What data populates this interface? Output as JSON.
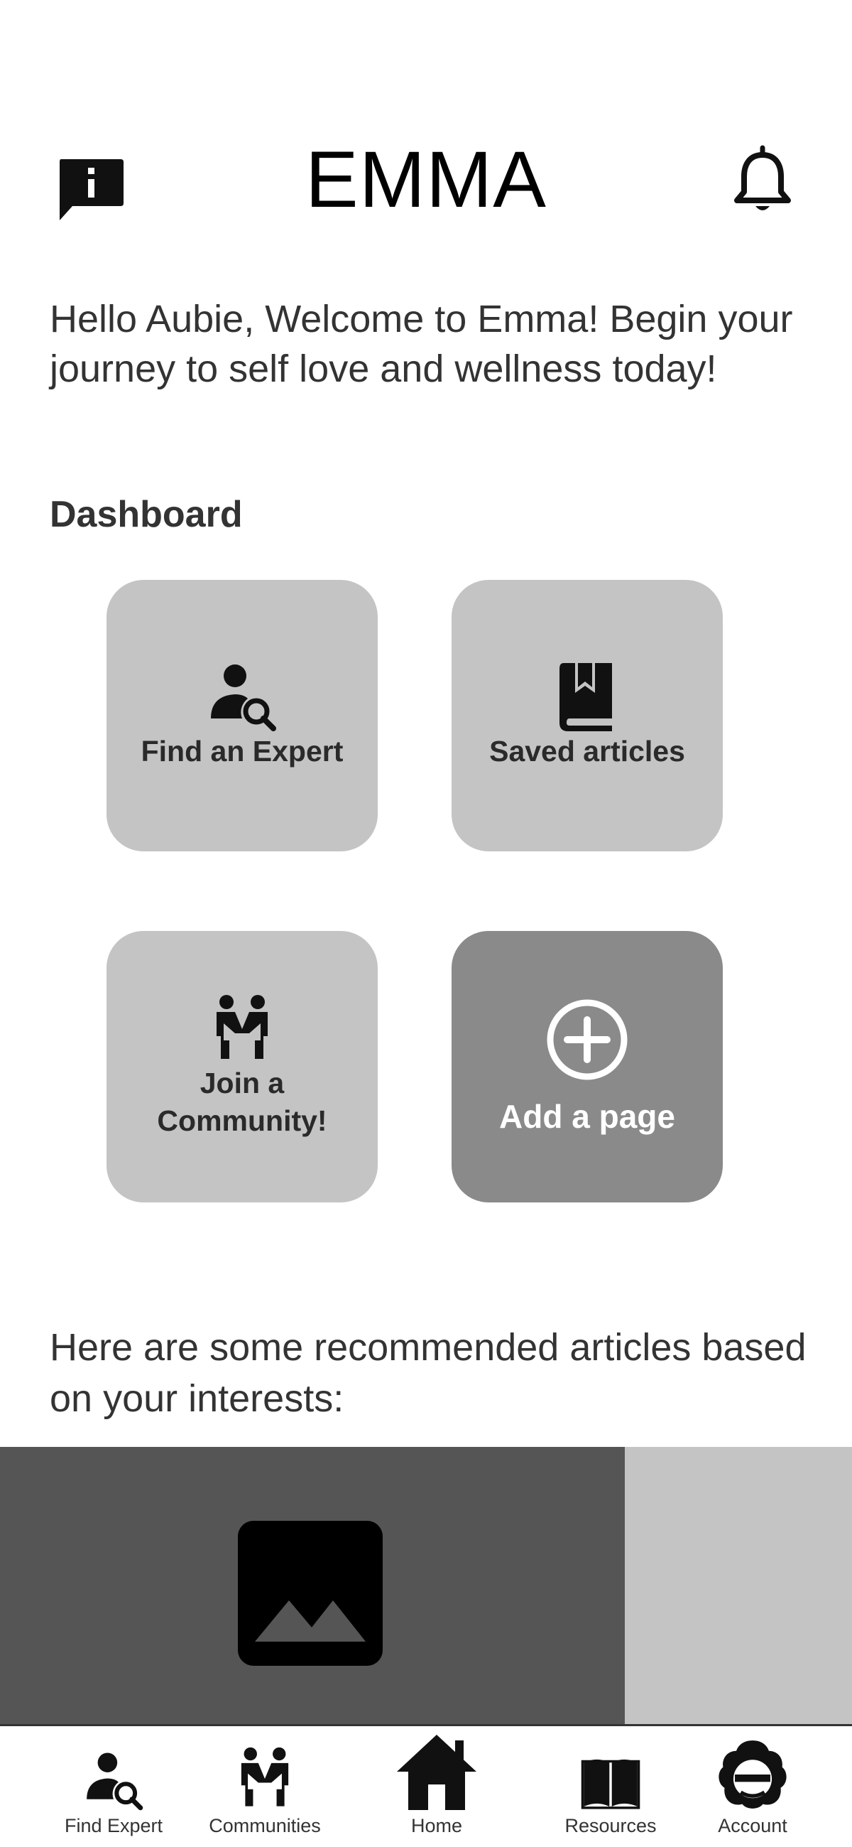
{
  "header": {
    "app_title": "EMMA",
    "left_icon": "chat-alert-icon",
    "right_icon": "bell-icon"
  },
  "welcome": {
    "text": "Hello Aubie, Welcome to Emma! Begin your journey to self love and wellness today!"
  },
  "dashboard": {
    "title": "Dashboard",
    "tiles": [
      {
        "label": "Find an Expert",
        "icon": "person-search-icon"
      },
      {
        "label": "Saved articles",
        "icon": "bookmark-book-icon"
      },
      {
        "label": "Join a Community!",
        "icon": "people-icon"
      },
      {
        "label": "Add a page",
        "icon": "plus-circle-icon"
      }
    ]
  },
  "recommended": {
    "text": "Here are some recommended articles based on your interests:",
    "card_icon": "image-placeholder-icon"
  },
  "bottom_nav": {
    "items": [
      {
        "label": "Find Expert",
        "icon": "person-search-icon"
      },
      {
        "label": "Communities",
        "icon": "people-icon"
      },
      {
        "label": "Home",
        "icon": "home-icon"
      },
      {
        "label": "Resources",
        "icon": "book-icon"
      },
      {
        "label": "Account",
        "icon": "account-avatar-icon"
      }
    ]
  },
  "colors": {
    "tile": "#c4c4c4",
    "tile_dark": "#8a8a8a",
    "card": "#555555",
    "text": "#333333"
  }
}
